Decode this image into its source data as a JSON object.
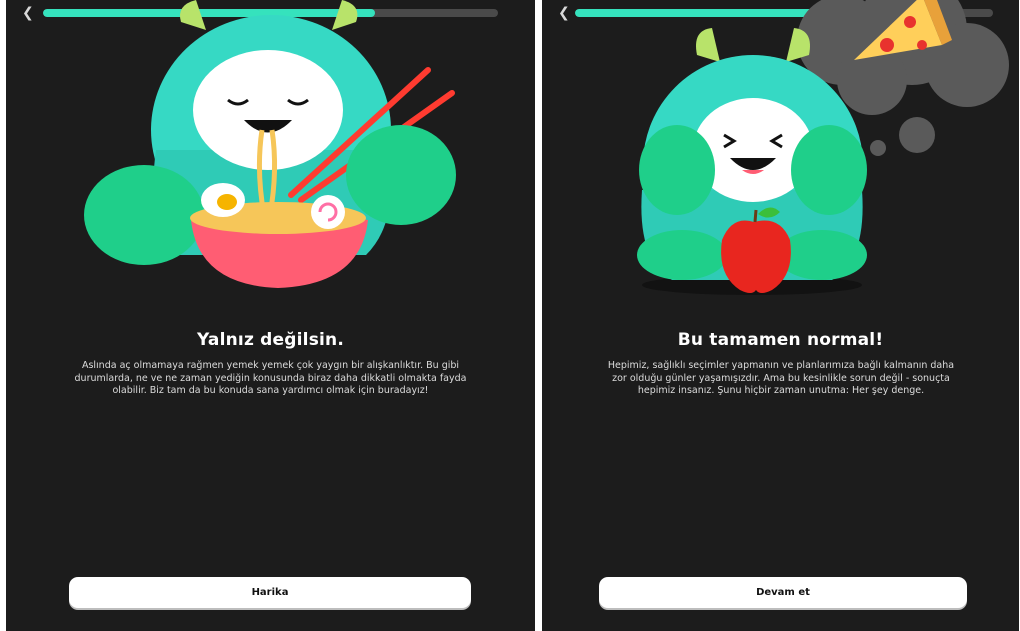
{
  "screens": [
    {
      "title": "Yalnız değilsin.",
      "body": "Aslında aç olmamaya rağmen yemek yemek çok yaygın bir alışkanlıktır. Bu gibi durumlarda, ne ve ne zaman yediğin konusunda biraz daha dikkatli olmakta fayda olabilir. Biz tam da bu konuda sana yardımcı olmak için buradayız!",
      "button_label": "Harika",
      "progress": 0.73,
      "back_icon": "chevron-left-icon"
    },
    {
      "title": "Bu tamamen normal!",
      "body": "Hepimiz, sağlıklı seçimler yapmanın ve planlarımıza bağlı kalmanın daha zor olduğu günler yaşamışızdır. Ama bu kesinlikle sorun değil - sonuçta hepimiz insanız. Şunu hiçbir zaman unutma: Her şey denge.",
      "button_label": "Devam et",
      "progress": 0.7,
      "back_icon": "chevron-left-icon"
    }
  ],
  "colors": {
    "background": "#1c1c1c",
    "accent": "#35e2bd",
    "monster_body": "#36d9c4",
    "monster_hands": "#1fcf8a",
    "bowl": "#ff5d73",
    "chopsticks": "#ff3b30",
    "apple": "#e8261f",
    "button": "#ffffff"
  }
}
